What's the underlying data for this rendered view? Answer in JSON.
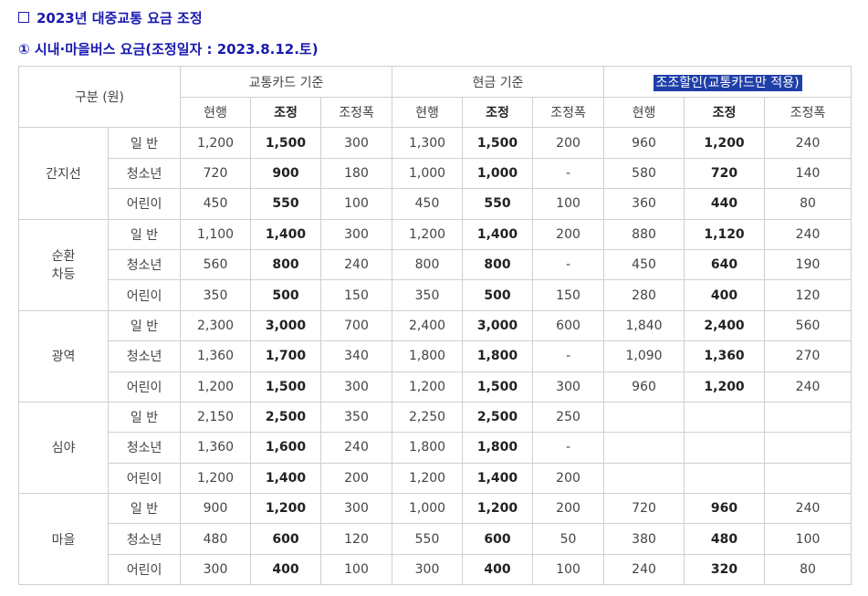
{
  "heading": "2023년 대중교통 요금 조정",
  "subheading": "① 시내·마을버스 요금(조정일자 : 2023.8.12.토)",
  "table": {
    "corner": "구분 (원)",
    "groups": [
      "교통카드 기준",
      "현금 기준",
      "조조할인(교통카드만 적용)"
    ],
    "subheads": [
      "현행",
      "조정",
      "조정폭",
      "현행",
      "조정",
      "조정폭",
      "현행",
      "조정",
      "조정폭"
    ],
    "categories": [
      {
        "name": "간지선",
        "rows": [
          {
            "type": "일 반",
            "vals": [
              "1,200",
              "1,500",
              "300",
              "1,300",
              "1,500",
              "200",
              "960",
              "1,200",
              "240"
            ]
          },
          {
            "type": "청소년",
            "vals": [
              "720",
              "900",
              "180",
              "1,000",
              "1,000",
              "-",
              "580",
              "720",
              "140"
            ]
          },
          {
            "type": "어린이",
            "vals": [
              "450",
              "550",
              "100",
              "450",
              "550",
              "100",
              "360",
              "440",
              "80"
            ]
          }
        ]
      },
      {
        "name": "순환\n차등",
        "rows": [
          {
            "type": "일 반",
            "vals": [
              "1,100",
              "1,400",
              "300",
              "1,200",
              "1,400",
              "200",
              "880",
              "1,120",
              "240"
            ]
          },
          {
            "type": "청소년",
            "vals": [
              "560",
              "800",
              "240",
              "800",
              "800",
              "-",
              "450",
              "640",
              "190"
            ]
          },
          {
            "type": "어린이",
            "vals": [
              "350",
              "500",
              "150",
              "350",
              "500",
              "150",
              "280",
              "400",
              "120"
            ]
          }
        ]
      },
      {
        "name": "광역",
        "rows": [
          {
            "type": "일 반",
            "vals": [
              "2,300",
              "3,000",
              "700",
              "2,400",
              "3,000",
              "600",
              "1,840",
              "2,400",
              "560"
            ]
          },
          {
            "type": "청소년",
            "vals": [
              "1,360",
              "1,700",
              "340",
              "1,800",
              "1,800",
              "-",
              "1,090",
              "1,360",
              "270"
            ]
          },
          {
            "type": "어린이",
            "vals": [
              "1,200",
              "1,500",
              "300",
              "1,200",
              "1,500",
              "300",
              "960",
              "1,200",
              "240"
            ]
          }
        ]
      },
      {
        "name": "심야",
        "rows": [
          {
            "type": "일 반",
            "vals": [
              "2,150",
              "2,500",
              "350",
              "2,250",
              "2,500",
              "250",
              "",
              "",
              ""
            ]
          },
          {
            "type": "청소년",
            "vals": [
              "1,360",
              "1,600",
              "240",
              "1,800",
              "1,800",
              "-",
              "",
              "",
              ""
            ]
          },
          {
            "type": "어린이",
            "vals": [
              "1,200",
              "1,400",
              "200",
              "1,200",
              "1,400",
              "200",
              "",
              "",
              ""
            ]
          }
        ]
      },
      {
        "name": "마을",
        "rows": [
          {
            "type": "일 반",
            "vals": [
              "900",
              "1,200",
              "300",
              "1,000",
              "1,200",
              "200",
              "720",
              "960",
              "240"
            ]
          },
          {
            "type": "청소년",
            "vals": [
              "480",
              "600",
              "120",
              "550",
              "600",
              "50",
              "380",
              "480",
              "100"
            ]
          },
          {
            "type": "어린이",
            "vals": [
              "300",
              "400",
              "100",
              "300",
              "400",
              "100",
              "240",
              "320",
              "80"
            ]
          }
        ]
      }
    ]
  }
}
